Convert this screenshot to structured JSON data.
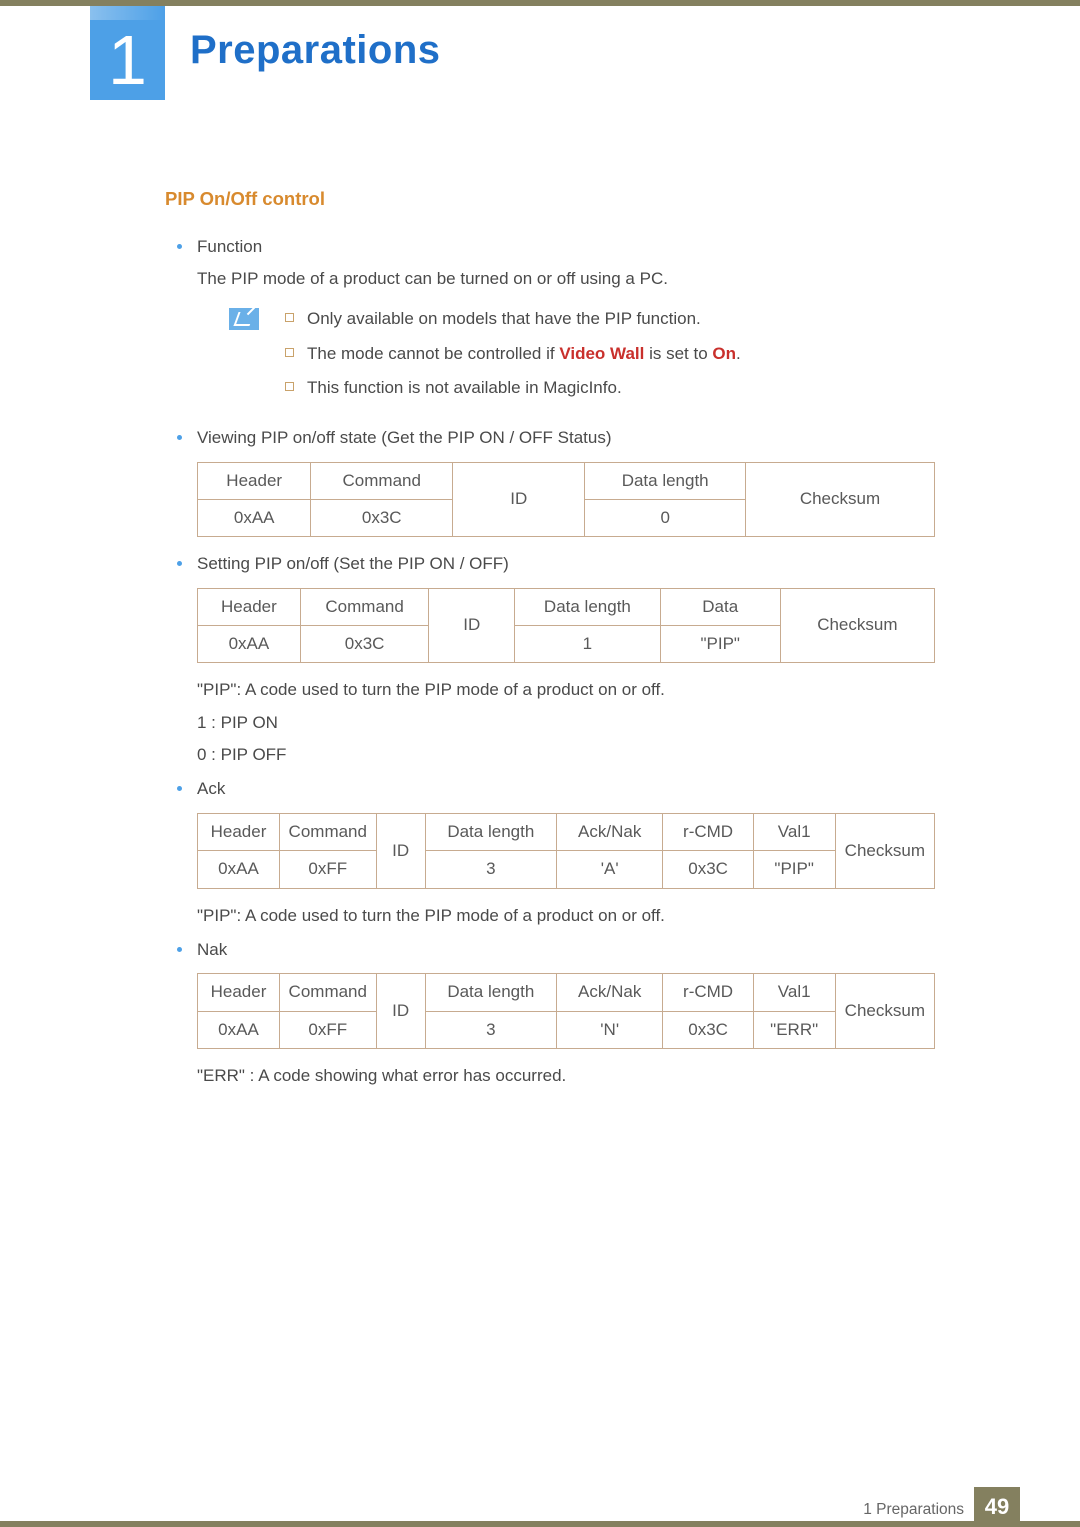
{
  "chapter": {
    "number": "1",
    "title": "Preparations"
  },
  "section": {
    "title": "PIP On/Off control"
  },
  "func": {
    "label": "Function",
    "desc": "The PIP mode of a product can be turned on or off using a PC."
  },
  "notes": {
    "n1": "Only available on models that have the PIP function.",
    "n2a": "The mode cannot be controlled if ",
    "n2b": "Video Wall",
    "n2c": " is set to ",
    "n2d": "On",
    "n2e": ".",
    "n3": "This function is not available in MagicInfo."
  },
  "view": {
    "label": "Viewing PIP on/off state (Get the PIP ON / OFF Status)"
  },
  "t1": {
    "h_header": "Header",
    "h_cmd": "Command",
    "h_id": "ID",
    "h_dlen": "Data length",
    "h_chk": "Checksum",
    "v_header": "0xAA",
    "v_cmd": "0x3C",
    "v_dlen": "0"
  },
  "set": {
    "label": "Setting PIP on/off (Set the PIP ON / OFF)"
  },
  "t2": {
    "h_header": "Header",
    "h_cmd": "Command",
    "h_id": "ID",
    "h_dlen": "Data length",
    "h_data": "Data",
    "h_chk": "Checksum",
    "v_header": "0xAA",
    "v_cmd": "0x3C",
    "v_dlen": "1",
    "v_data": "\"PIP\""
  },
  "pip_desc": "\"PIP\": A code used to turn the PIP mode of a product on or off.",
  "pip_on": "1 : PIP ON",
  "pip_off": "0 : PIP OFF",
  "ack": {
    "label": "Ack"
  },
  "t3": {
    "h_header": "Header",
    "h_cmd": "Command",
    "h_id": "ID",
    "h_dlen": "Data length",
    "h_an": "Ack/Nak",
    "h_rcmd": "r-CMD",
    "h_val": "Val1",
    "h_chk": "Checksum",
    "v_header": "0xAA",
    "v_cmd": "0xFF",
    "v_dlen": "3",
    "v_an": "'A'",
    "v_rcmd": "0x3C",
    "v_val": "\"PIP\""
  },
  "ack_desc": "\"PIP\": A code used to turn the PIP mode of a product on or off.",
  "nak": {
    "label": "Nak"
  },
  "t4": {
    "h_header": "Header",
    "h_cmd": "Command",
    "h_id": "ID",
    "h_dlen": "Data length",
    "h_an": "Ack/Nak",
    "h_rcmd": "r-CMD",
    "h_val": "Val1",
    "h_chk": "Checksum",
    "v_header": "0xAA",
    "v_cmd": "0xFF",
    "v_dlen": "3",
    "v_an": "'N'",
    "v_rcmd": "0x3C",
    "v_val": "\"ERR\""
  },
  "nak_desc": "\"ERR\" : A code showing what error has occurred.",
  "footer": {
    "label": "1 Preparations",
    "page": "49"
  }
}
